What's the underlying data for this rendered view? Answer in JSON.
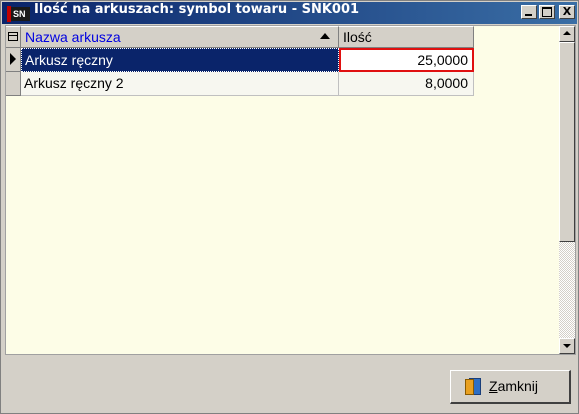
{
  "window": {
    "title": "Ilość na arkuszach: symbol towaru - SNK001",
    "app_icon_text": "SN",
    "controls": {
      "minimize": "",
      "maximize": "",
      "close": "X"
    }
  },
  "grid": {
    "columns": [
      {
        "label": "Nazwa arkusza",
        "sort": "ascending",
        "color": "#0000e0"
      },
      {
        "label": "Ilość"
      }
    ],
    "rows": [
      {
        "name": "Arkusz ręczny",
        "qty": "25,0000",
        "selected": true
      },
      {
        "name": "Arkusz ręczny 2",
        "qty": "8,0000",
        "selected": false
      }
    ],
    "background_color": "#fdfde7",
    "selection_color": "#0a246a",
    "edit_border_color": "#e01010"
  },
  "footer": {
    "close_button": {
      "accel": "Z",
      "rest": "amknij",
      "icon": "door-exit-icon"
    }
  }
}
